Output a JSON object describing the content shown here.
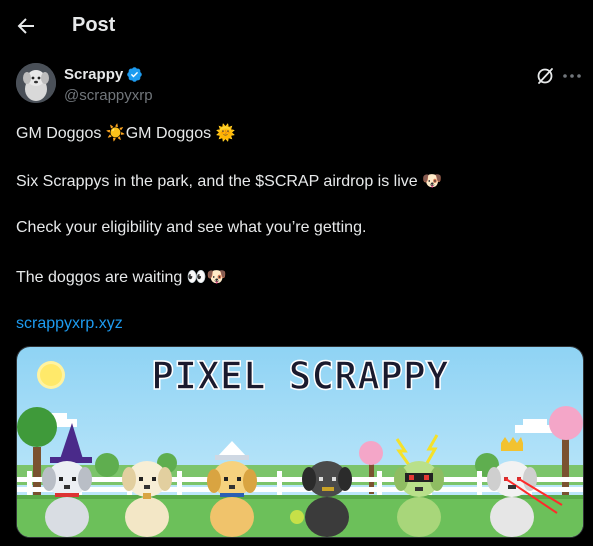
{
  "header": {
    "title": "Post"
  },
  "author": {
    "name": "Scrappy",
    "handle": "@scrappyxrp"
  },
  "tweet": {
    "line1": "GM Doggos ☀️GM Doggos 🌞",
    "line2": "Six Scrappys in the park, and the $SCRAP airdrop is live 🐶",
    "line3": "Check your eligibility and see what you’re getting.",
    "line4": "The doggos are waiting 👀🐶",
    "link": "scrappyxrp.xyz"
  },
  "media": {
    "title": "PIXEL SCRAPPY"
  },
  "colors": {
    "accent": "#1d9bf0",
    "background": "#000000",
    "text": "#e7e9ea",
    "muted": "#71767b"
  },
  "icons": [
    "back-arrow-icon",
    "verified-badge-icon",
    "grok-icon",
    "more-icon"
  ]
}
